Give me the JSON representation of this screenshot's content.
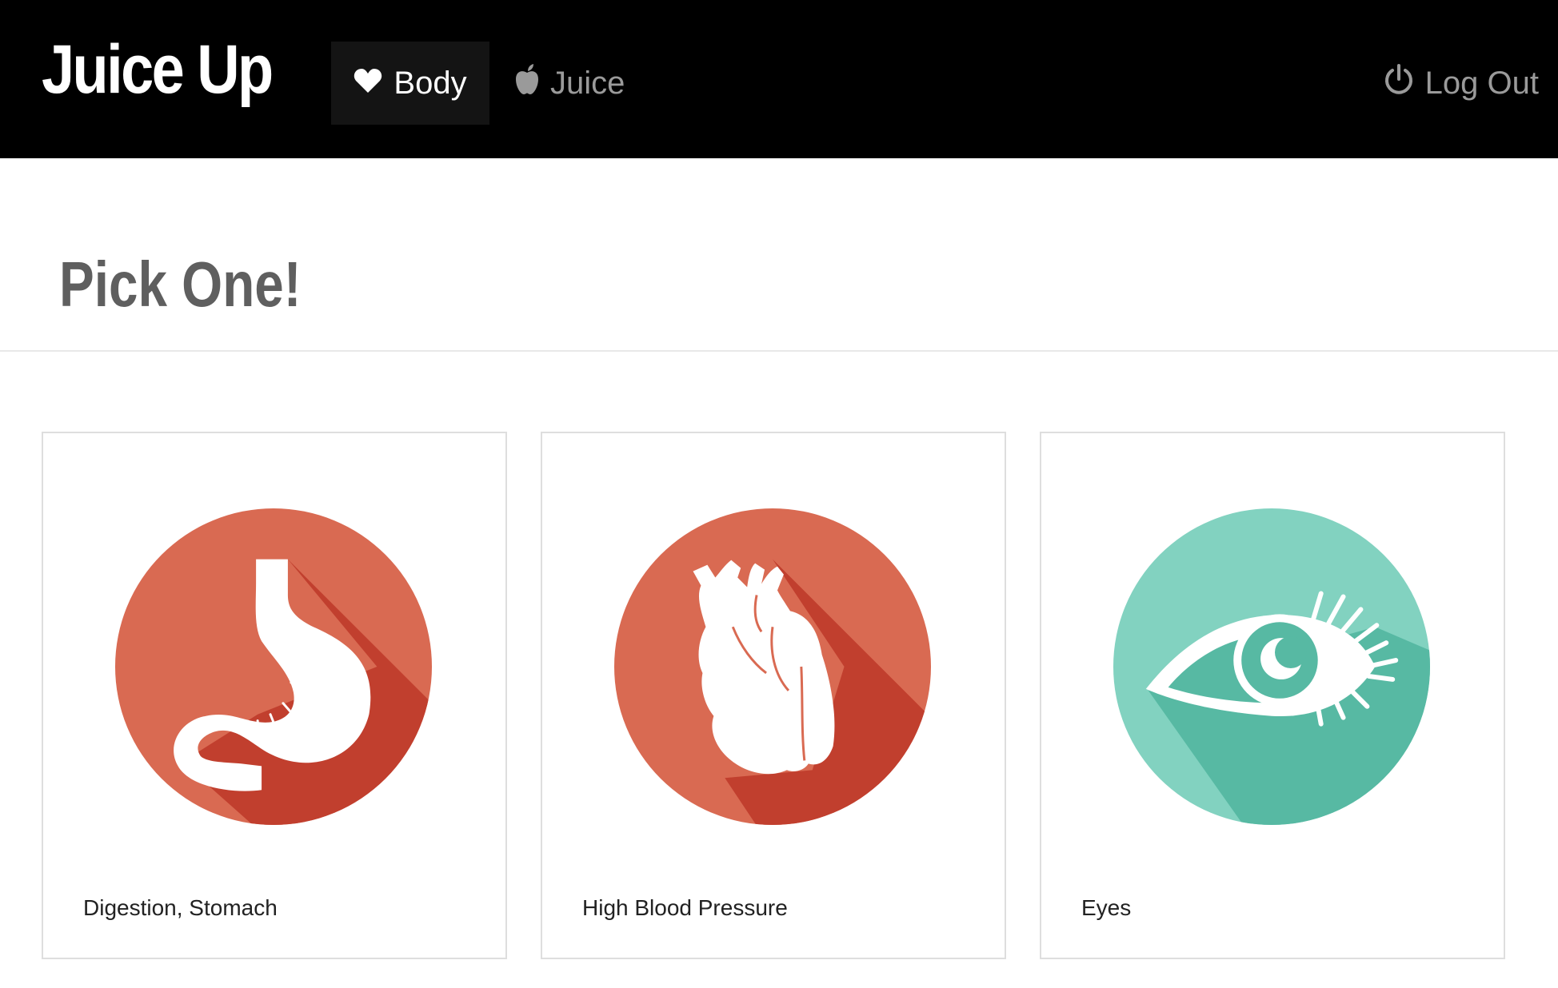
{
  "app": {
    "brand": "Juice Up"
  },
  "nav": {
    "items": [
      {
        "label": "Body",
        "icon": "heart-icon",
        "active": true
      },
      {
        "label": "Juice",
        "icon": "apple-icon",
        "active": false
      }
    ],
    "logout": {
      "label": "Log Out",
      "icon": "power-icon"
    }
  },
  "page": {
    "title": "Pick One!"
  },
  "cards": [
    {
      "label": "Digestion, Stomach",
      "icon": "stomach-icon",
      "color": "#d96a52",
      "shadow": "#c13f2e"
    },
    {
      "label": "High Blood Pressure",
      "icon": "heart-organ-icon",
      "color": "#d96a52",
      "shadow": "#c13f2e"
    },
    {
      "label": "Eyes",
      "icon": "eye-icon",
      "color": "#82d2c0",
      "shadow": "#57b9a3"
    }
  ]
}
